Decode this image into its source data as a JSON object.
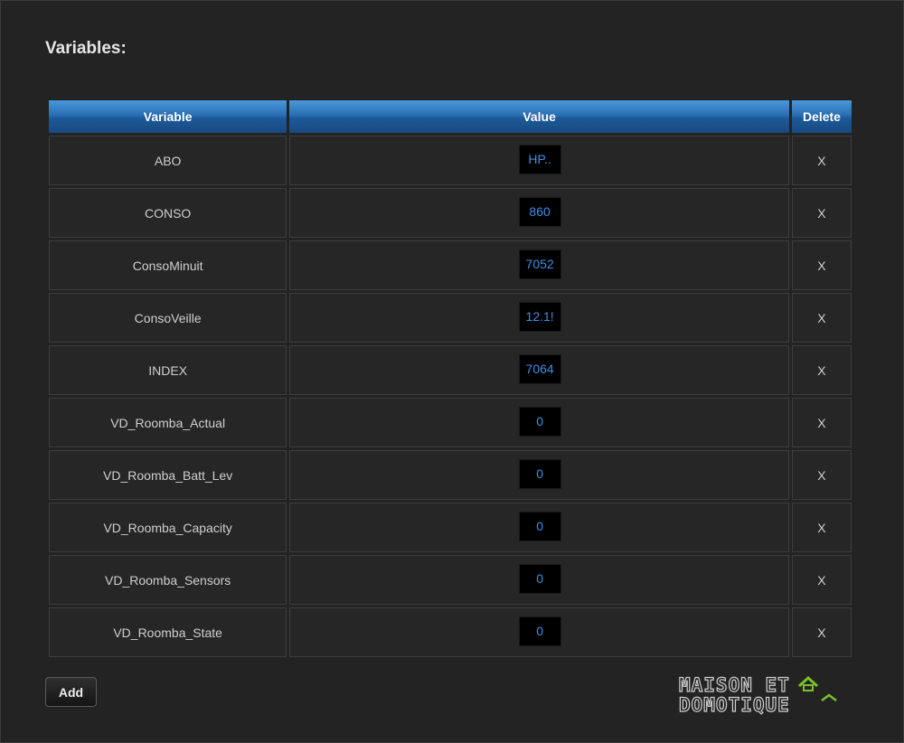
{
  "section": {
    "title": "Variables:"
  },
  "table": {
    "headers": {
      "variable": "Variable",
      "value": "Value",
      "delete": "Delete"
    },
    "rows": [
      {
        "name": "ABO",
        "value": "HP..",
        "delete": "X"
      },
      {
        "name": "CONSO",
        "value": "860",
        "delete": "X"
      },
      {
        "name": "ConsoMinuit",
        "value": "7052",
        "delete": "X"
      },
      {
        "name": "ConsoVeille",
        "value": "12.1!",
        "delete": "X"
      },
      {
        "name": "INDEX",
        "value": "7064",
        "delete": "X"
      },
      {
        "name": "VD_Roomba_Actual",
        "value": "0",
        "delete": "X"
      },
      {
        "name": "VD_Roomba_Batt_Lev",
        "value": "0",
        "delete": "X"
      },
      {
        "name": "VD_Roomba_Capacity",
        "value": "0",
        "delete": "X"
      },
      {
        "name": "VD_Roomba_Sensors",
        "value": "0",
        "delete": "X"
      },
      {
        "name": "VD_Roomba_State",
        "value": "0",
        "delete": "X"
      }
    ]
  },
  "buttons": {
    "add_label": "Add"
  },
  "logo": {
    "line1": "MAISON ET",
    "line2": "DOMOTIQUE",
    "accent_color": "#7cc12a"
  },
  "colors": {
    "header_blue": "#2a6fb5",
    "value_text": "#3f8fe6",
    "background": "#232323"
  }
}
